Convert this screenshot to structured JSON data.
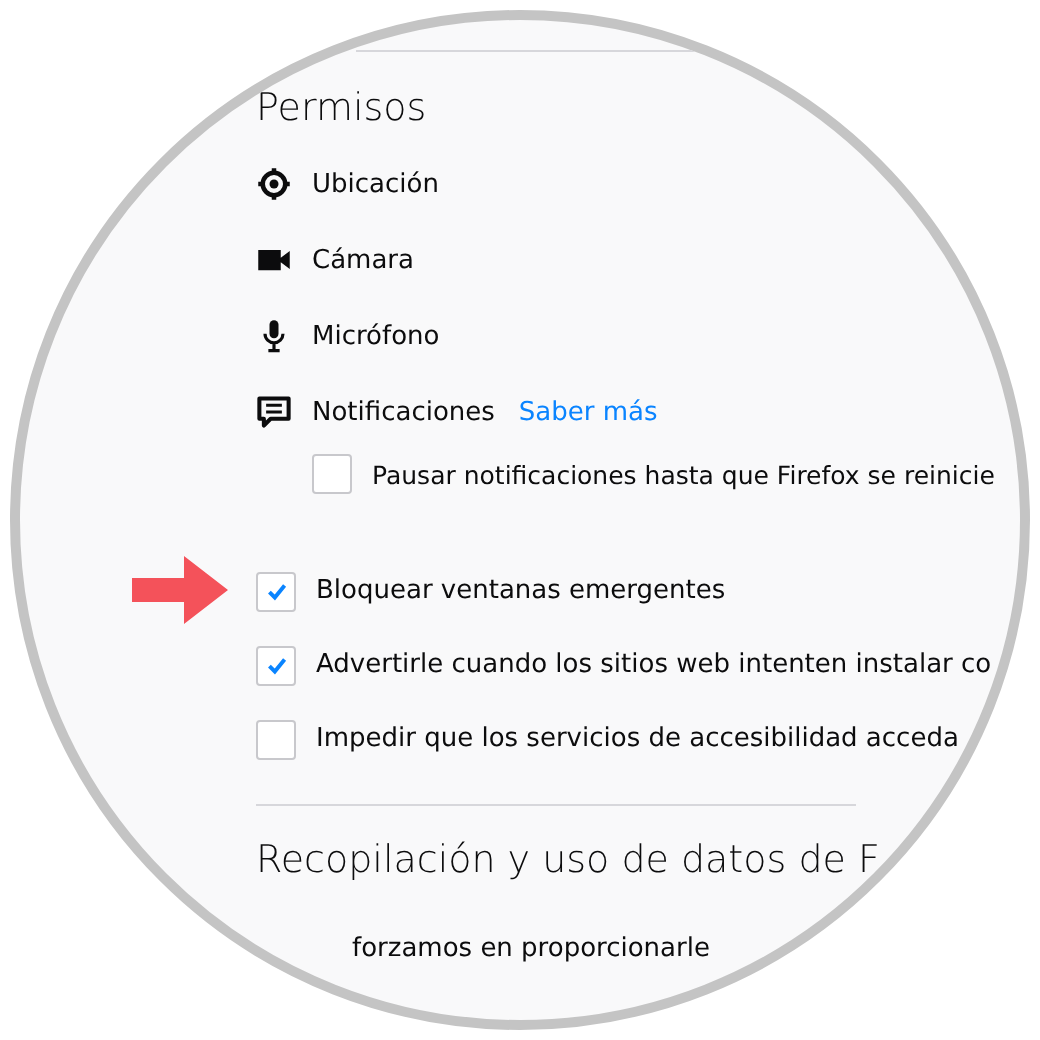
{
  "permissions": {
    "title": "Permisos",
    "items": [
      {
        "kind": "location",
        "label": "Ubicación"
      },
      {
        "kind": "camera",
        "label": "Cámara"
      },
      {
        "kind": "microphone",
        "label": "Micrófono"
      },
      {
        "kind": "notifications",
        "label": "Notificaciones",
        "link": "Saber más"
      }
    ],
    "pause": {
      "label": "Pausar notificaciones hasta que Firefox se reinicie",
      "checked": false
    }
  },
  "options": [
    {
      "label": "Bloquear ventanas emergentes",
      "checked": true,
      "highlighted": true
    },
    {
      "label": "Advertirle cuando los sitios web intenten instalar co",
      "checked": true,
      "highlighted": false
    },
    {
      "label": "Impedir que los servicios de accesibilidad acceda",
      "checked": false,
      "highlighted": false
    }
  ],
  "data_collection": {
    "title": "Recopilación y uso de datos de F",
    "text": "forzamos en proporcionarle"
  }
}
